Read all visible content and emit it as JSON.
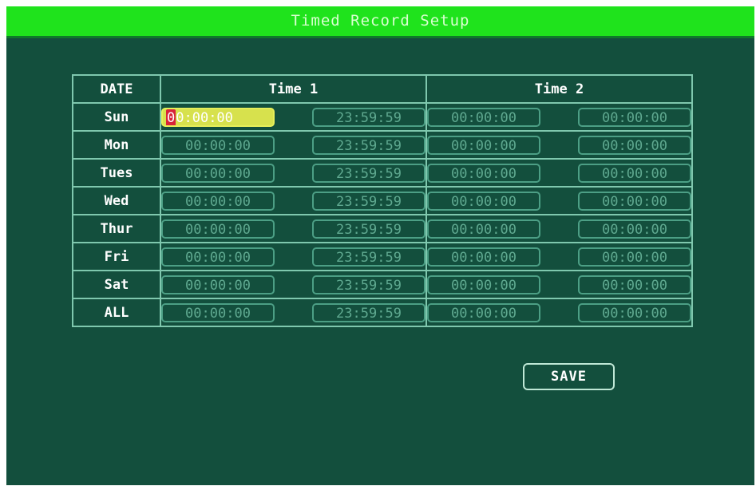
{
  "title": "Timed Record Setup",
  "columns": {
    "date": "DATE",
    "time1": "Time 1",
    "time2": "Time 2"
  },
  "rows": [
    {
      "day": "Sun",
      "t1_start": "00:00:00",
      "t1_end": "23:59:59",
      "t2_start": "00:00:00",
      "t2_end": "00:00:00"
    },
    {
      "day": "Mon",
      "t1_start": "00:00:00",
      "t1_end": "23:59:59",
      "t2_start": "00:00:00",
      "t2_end": "00:00:00"
    },
    {
      "day": "Tues",
      "t1_start": "00:00:00",
      "t1_end": "23:59:59",
      "t2_start": "00:00:00",
      "t2_end": "00:00:00"
    },
    {
      "day": "Wed",
      "t1_start": "00:00:00",
      "t1_end": "23:59:59",
      "t2_start": "00:00:00",
      "t2_end": "00:00:00"
    },
    {
      "day": "Thur",
      "t1_start": "00:00:00",
      "t1_end": "23:59:59",
      "t2_start": "00:00:00",
      "t2_end": "00:00:00"
    },
    {
      "day": "Fri",
      "t1_start": "00:00:00",
      "t1_end": "23:59:59",
      "t2_start": "00:00:00",
      "t2_end": "00:00:00"
    },
    {
      "day": "Sat",
      "t1_start": "00:00:00",
      "t1_end": "23:59:59",
      "t2_start": "00:00:00",
      "t2_end": "00:00:00"
    },
    {
      "day": "ALL",
      "t1_start": "00:00:00",
      "t1_end": "23:59:59",
      "t2_start": "00:00:00",
      "t2_end": "00:00:00"
    }
  ],
  "save_label": "SAVE",
  "colors": {
    "background": "#134f3d",
    "title_bar": "#1fe31c",
    "grid": "#7fc8ae",
    "field": "#5fa990",
    "active_field": "#d7e14d",
    "cursor": "#d8233a"
  }
}
